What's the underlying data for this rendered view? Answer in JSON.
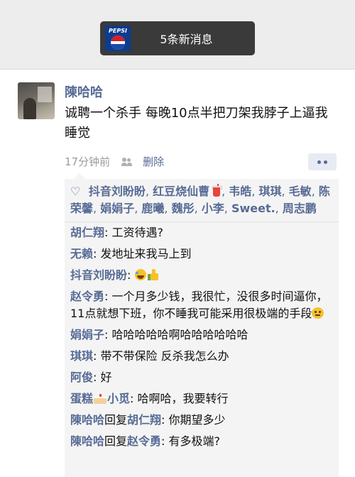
{
  "notification": {
    "thumbnail_logo": "PEPSI",
    "text": "5条新消息"
  },
  "post": {
    "author": "陳哈哈",
    "content": "诚聘一个杀手 每晚10点半把刀架我脖子上逼我睡觉",
    "time": "17分钟前",
    "delete_label": "删除"
  },
  "likes": {
    "icon": "heart-outline-icon",
    "names": [
      "抖音刘盼盼",
      "红豆烧仙曹",
      "韦皓",
      "琪琪",
      "毛敏",
      "陈荣馨",
      "娟娟子",
      "鹿曦",
      "魏彤",
      "小李",
      "Sweet.",
      "周志鹏"
    ],
    "separator": ", "
  },
  "comments": [
    {
      "name": "胡仁翔",
      "text": ": 工资待遇?"
    },
    {
      "name": "无赖",
      "text": ": 发地址来我马上到"
    },
    {
      "name": "抖音刘盼盼",
      "text": ": "
    },
    {
      "name": "赵令勇",
      "text": ": 一个月多少钱，我很忙，没很多时间逼你，11点就想下班，你不睡我可能采用很极端的手段"
    },
    {
      "name": "娟娟子",
      "text": ": 哈哈哈哈哈啊哈哈哈哈哈哈"
    },
    {
      "name": "琪琪",
      "text": ": 带不带保险 反杀我怎么办"
    },
    {
      "name": "阿俊",
      "text": ": 好"
    },
    {
      "name_a": "蛋糕",
      "name_b": "小觅",
      "text": ": 哈啊哈，我要转行"
    },
    {
      "name": "陳哈哈",
      "reply_word": "回复",
      "target": "胡仁翔",
      "text": ": 你期望多少"
    },
    {
      "name": "陳哈哈",
      "reply_word": "回复",
      "target": "赵令勇",
      "text": ": 有多极端?"
    }
  ],
  "colors": {
    "link": "#576b95",
    "banner_bg": "#3a3a3a",
    "panel_bg": "#f4f4f4",
    "meta_gray": "#9b9b9b"
  }
}
